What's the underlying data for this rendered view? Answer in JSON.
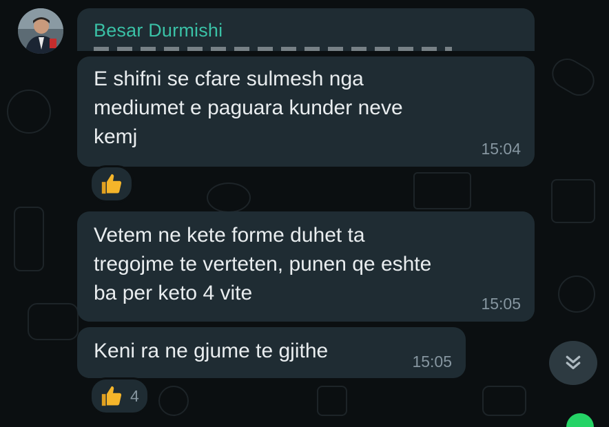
{
  "chat": {
    "sender_name": "Besar Durmishi",
    "messages": [
      {
        "text": "E shifni se cfare sulmesh nga\nmediumet e paguara kunder neve\nkemj",
        "time": "15:04",
        "reaction": "thumbs-up"
      },
      {
        "text": "Vetem ne kete forme duhet ta\ntregojme te verteten, punen qe eshte\nba per keto 4 vite",
        "time": "15:05"
      },
      {
        "text": "Keni ra ne gjume te gjithe",
        "time": "15:05",
        "reaction": "thumbs-up",
        "reaction_count": "4"
      }
    ]
  },
  "icons": {
    "reaction": "thumbs-up-icon",
    "scroll": "double-chevron-down-icon"
  },
  "colors": {
    "background": "#0b0f11",
    "bubble": "#1f2c33",
    "sender_name": "#3ac1a6",
    "timestamp": "#8696a0",
    "thumb": "#f5b52a"
  }
}
